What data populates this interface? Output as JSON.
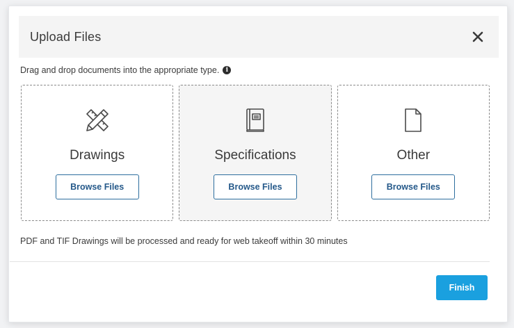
{
  "dialog": {
    "title": "Upload Files",
    "close_icon": "close-icon"
  },
  "instruction": {
    "text": "Drag and drop documents into the appropriate type.",
    "info_icon": "info-icon",
    "info_glyph": "i"
  },
  "zones": [
    {
      "label": "Drawings",
      "icon": "pencil-ruler-icon",
      "button_label": "Browse Files"
    },
    {
      "label": "Specifications",
      "icon": "book-icon",
      "button_label": "Browse Files"
    },
    {
      "label": "Other",
      "icon": "document-icon",
      "button_label": "Browse Files"
    }
  ],
  "note": "PDF and TIF Drawings will be processed and ready for web takeoff within 30 minutes",
  "footer": {
    "finish_label": "Finish"
  },
  "colors": {
    "primary_button": "#1aa0df",
    "outline_button": "#2d6e9e",
    "header_bg": "#f4f4f4"
  }
}
